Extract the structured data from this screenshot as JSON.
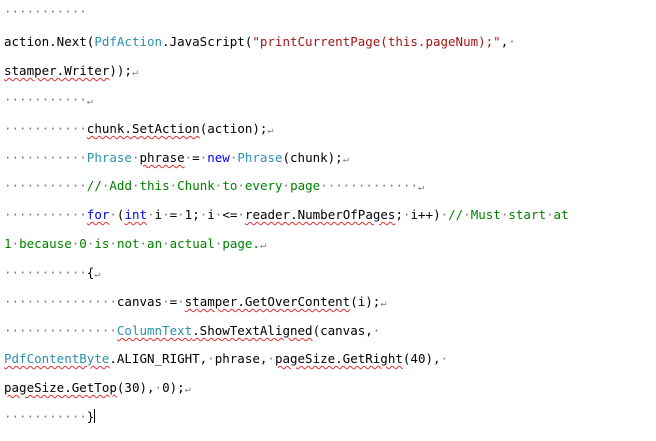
{
  "document": {
    "colors": {
      "type": "#2b91af",
      "keyword": "#0000ff",
      "string": "#a31515",
      "comment": "#008000",
      "default": "#000000",
      "marks": "#7a7a7a",
      "spelling": "#e03030"
    },
    "pilcrow": "↵",
    "lines": [
      [
        {
          "t": "sp",
          "v": "···········"
        }
      ],
      [
        {
          "t": "def",
          "v": "action.Next("
        },
        {
          "t": "type",
          "v": "PdfAction"
        },
        {
          "t": "def",
          "v": ".JavaScript("
        },
        {
          "t": "str",
          "v": "\"printCurrentPage(this.pageNum);\""
        },
        {
          "t": "def",
          "v": ","
        },
        {
          "t": "sp",
          "v": "·"
        }
      ],
      [
        {
          "t": "def",
          "v": "stamper.Writer",
          "sq": true
        },
        {
          "t": "def",
          "v": "));"
        },
        {
          "t": "pm"
        }
      ],
      [
        {
          "t": "sp",
          "v": "···········"
        },
        {
          "t": "pm"
        }
      ],
      [
        {
          "t": "sp",
          "v": "···········"
        },
        {
          "t": "def",
          "v": "chunk.SetAction",
          "sq": true
        },
        {
          "t": "def",
          "v": "(action);"
        },
        {
          "t": "pm"
        }
      ],
      [
        {
          "t": "sp",
          "v": "···········"
        },
        {
          "t": "type",
          "v": "Phrase"
        },
        {
          "t": "sp",
          "v": "·"
        },
        {
          "t": "def",
          "v": "phrase",
          "sq": true
        },
        {
          "t": "sp",
          "v": "·"
        },
        {
          "t": "def",
          "v": "="
        },
        {
          "t": "sp",
          "v": "·"
        },
        {
          "t": "kw",
          "v": "new"
        },
        {
          "t": "sp",
          "v": "·"
        },
        {
          "t": "type",
          "v": "Phrase"
        },
        {
          "t": "def",
          "v": "(chunk);"
        },
        {
          "t": "pm"
        }
      ],
      [
        {
          "t": "sp",
          "v": "···········"
        },
        {
          "t": "com",
          "v": "//"
        },
        {
          "t": "sp",
          "v": "·"
        },
        {
          "t": "com",
          "v": "Add"
        },
        {
          "t": "sp",
          "v": "·"
        },
        {
          "t": "com",
          "v": "this"
        },
        {
          "t": "sp",
          "v": "·"
        },
        {
          "t": "com",
          "v": "Chunk"
        },
        {
          "t": "sp",
          "v": "·"
        },
        {
          "t": "com",
          "v": "to"
        },
        {
          "t": "sp",
          "v": "·"
        },
        {
          "t": "com",
          "v": "every"
        },
        {
          "t": "sp",
          "v": "·"
        },
        {
          "t": "com",
          "v": "page"
        },
        {
          "t": "sp",
          "v": "·············"
        },
        {
          "t": "pm"
        }
      ],
      [
        {
          "t": "sp",
          "v": "···········"
        },
        {
          "t": "kw",
          "v": "for",
          "sq": true
        },
        {
          "t": "sp",
          "v": "·"
        },
        {
          "t": "def",
          "v": "("
        },
        {
          "t": "kw",
          "v": "int",
          "sq": true
        },
        {
          "t": "sp",
          "v": "·"
        },
        {
          "t": "def",
          "v": "i"
        },
        {
          "t": "sp",
          "v": "·"
        },
        {
          "t": "def",
          "v": "="
        },
        {
          "t": "sp",
          "v": "·"
        },
        {
          "t": "def",
          "v": "1;"
        },
        {
          "t": "sp",
          "v": "·"
        },
        {
          "t": "def",
          "v": "i"
        },
        {
          "t": "sp",
          "v": "·"
        },
        {
          "t": "def",
          "v": "<="
        },
        {
          "t": "sp",
          "v": "·"
        },
        {
          "t": "def",
          "v": "reader.NumberOfPages",
          "sq": true
        },
        {
          "t": "def",
          "v": ";"
        },
        {
          "t": "sp",
          "v": "·"
        },
        {
          "t": "def",
          "v": "i++)"
        },
        {
          "t": "sp",
          "v": "·"
        },
        {
          "t": "com",
          "v": "//"
        },
        {
          "t": "sp",
          "v": "·"
        },
        {
          "t": "com",
          "v": "Must"
        },
        {
          "t": "sp",
          "v": "·"
        },
        {
          "t": "com",
          "v": "start"
        },
        {
          "t": "sp",
          "v": "·"
        },
        {
          "t": "com",
          "v": "at"
        }
      ],
      [
        {
          "t": "com",
          "v": "1"
        },
        {
          "t": "sp",
          "v": "·"
        },
        {
          "t": "com",
          "v": "because"
        },
        {
          "t": "sp",
          "v": "·"
        },
        {
          "t": "com",
          "v": "0"
        },
        {
          "t": "sp",
          "v": "·"
        },
        {
          "t": "com",
          "v": "is"
        },
        {
          "t": "sp",
          "v": "·"
        },
        {
          "t": "com",
          "v": "not"
        },
        {
          "t": "sp",
          "v": "·"
        },
        {
          "t": "com",
          "v": "an"
        },
        {
          "t": "sp",
          "v": "·"
        },
        {
          "t": "com",
          "v": "actual"
        },
        {
          "t": "sp",
          "v": "·"
        },
        {
          "t": "com",
          "v": "page."
        },
        {
          "t": "pm"
        }
      ],
      [
        {
          "t": "sp",
          "v": "···········"
        },
        {
          "t": "def",
          "v": "{"
        },
        {
          "t": "pm"
        }
      ],
      [
        {
          "t": "sp",
          "v": "···············"
        },
        {
          "t": "def",
          "v": "canvas"
        },
        {
          "t": "sp",
          "v": "·"
        },
        {
          "t": "def",
          "v": "="
        },
        {
          "t": "sp",
          "v": "·"
        },
        {
          "t": "def",
          "v": "stamper.GetOverContent",
          "sq": true
        },
        {
          "t": "def",
          "v": "(i);"
        },
        {
          "t": "pm"
        }
      ],
      [
        {
          "t": "sp",
          "v": "···············"
        },
        {
          "t": "type",
          "v": "ColumnText",
          "sq": true
        },
        {
          "t": "def",
          "v": ".ShowTextAligned",
          "sq": true
        },
        {
          "t": "def",
          "v": "(canvas,"
        },
        {
          "t": "sp",
          "v": "·"
        }
      ],
      [
        {
          "t": "type",
          "v": "PdfContentByte",
          "sq": true
        },
        {
          "t": "def",
          "v": ".ALIGN_RIGHT,"
        },
        {
          "t": "sp",
          "v": "·"
        },
        {
          "t": "def",
          "v": "phrase,"
        },
        {
          "t": "sp",
          "v": "·"
        },
        {
          "t": "def",
          "v": "pageSize.GetRight",
          "sq": true
        },
        {
          "t": "def",
          "v": "(40),"
        },
        {
          "t": "sp",
          "v": "·"
        }
      ],
      [
        {
          "t": "def",
          "v": "pageSize.GetTop",
          "sq": true
        },
        {
          "t": "def",
          "v": "(30),"
        },
        {
          "t": "sp",
          "v": "·"
        },
        {
          "t": "def",
          "v": "0);"
        },
        {
          "t": "pm"
        }
      ],
      [
        {
          "t": "sp",
          "v": "···········"
        },
        {
          "t": "def",
          "v": "}"
        },
        {
          "t": "caret"
        }
      ]
    ]
  }
}
